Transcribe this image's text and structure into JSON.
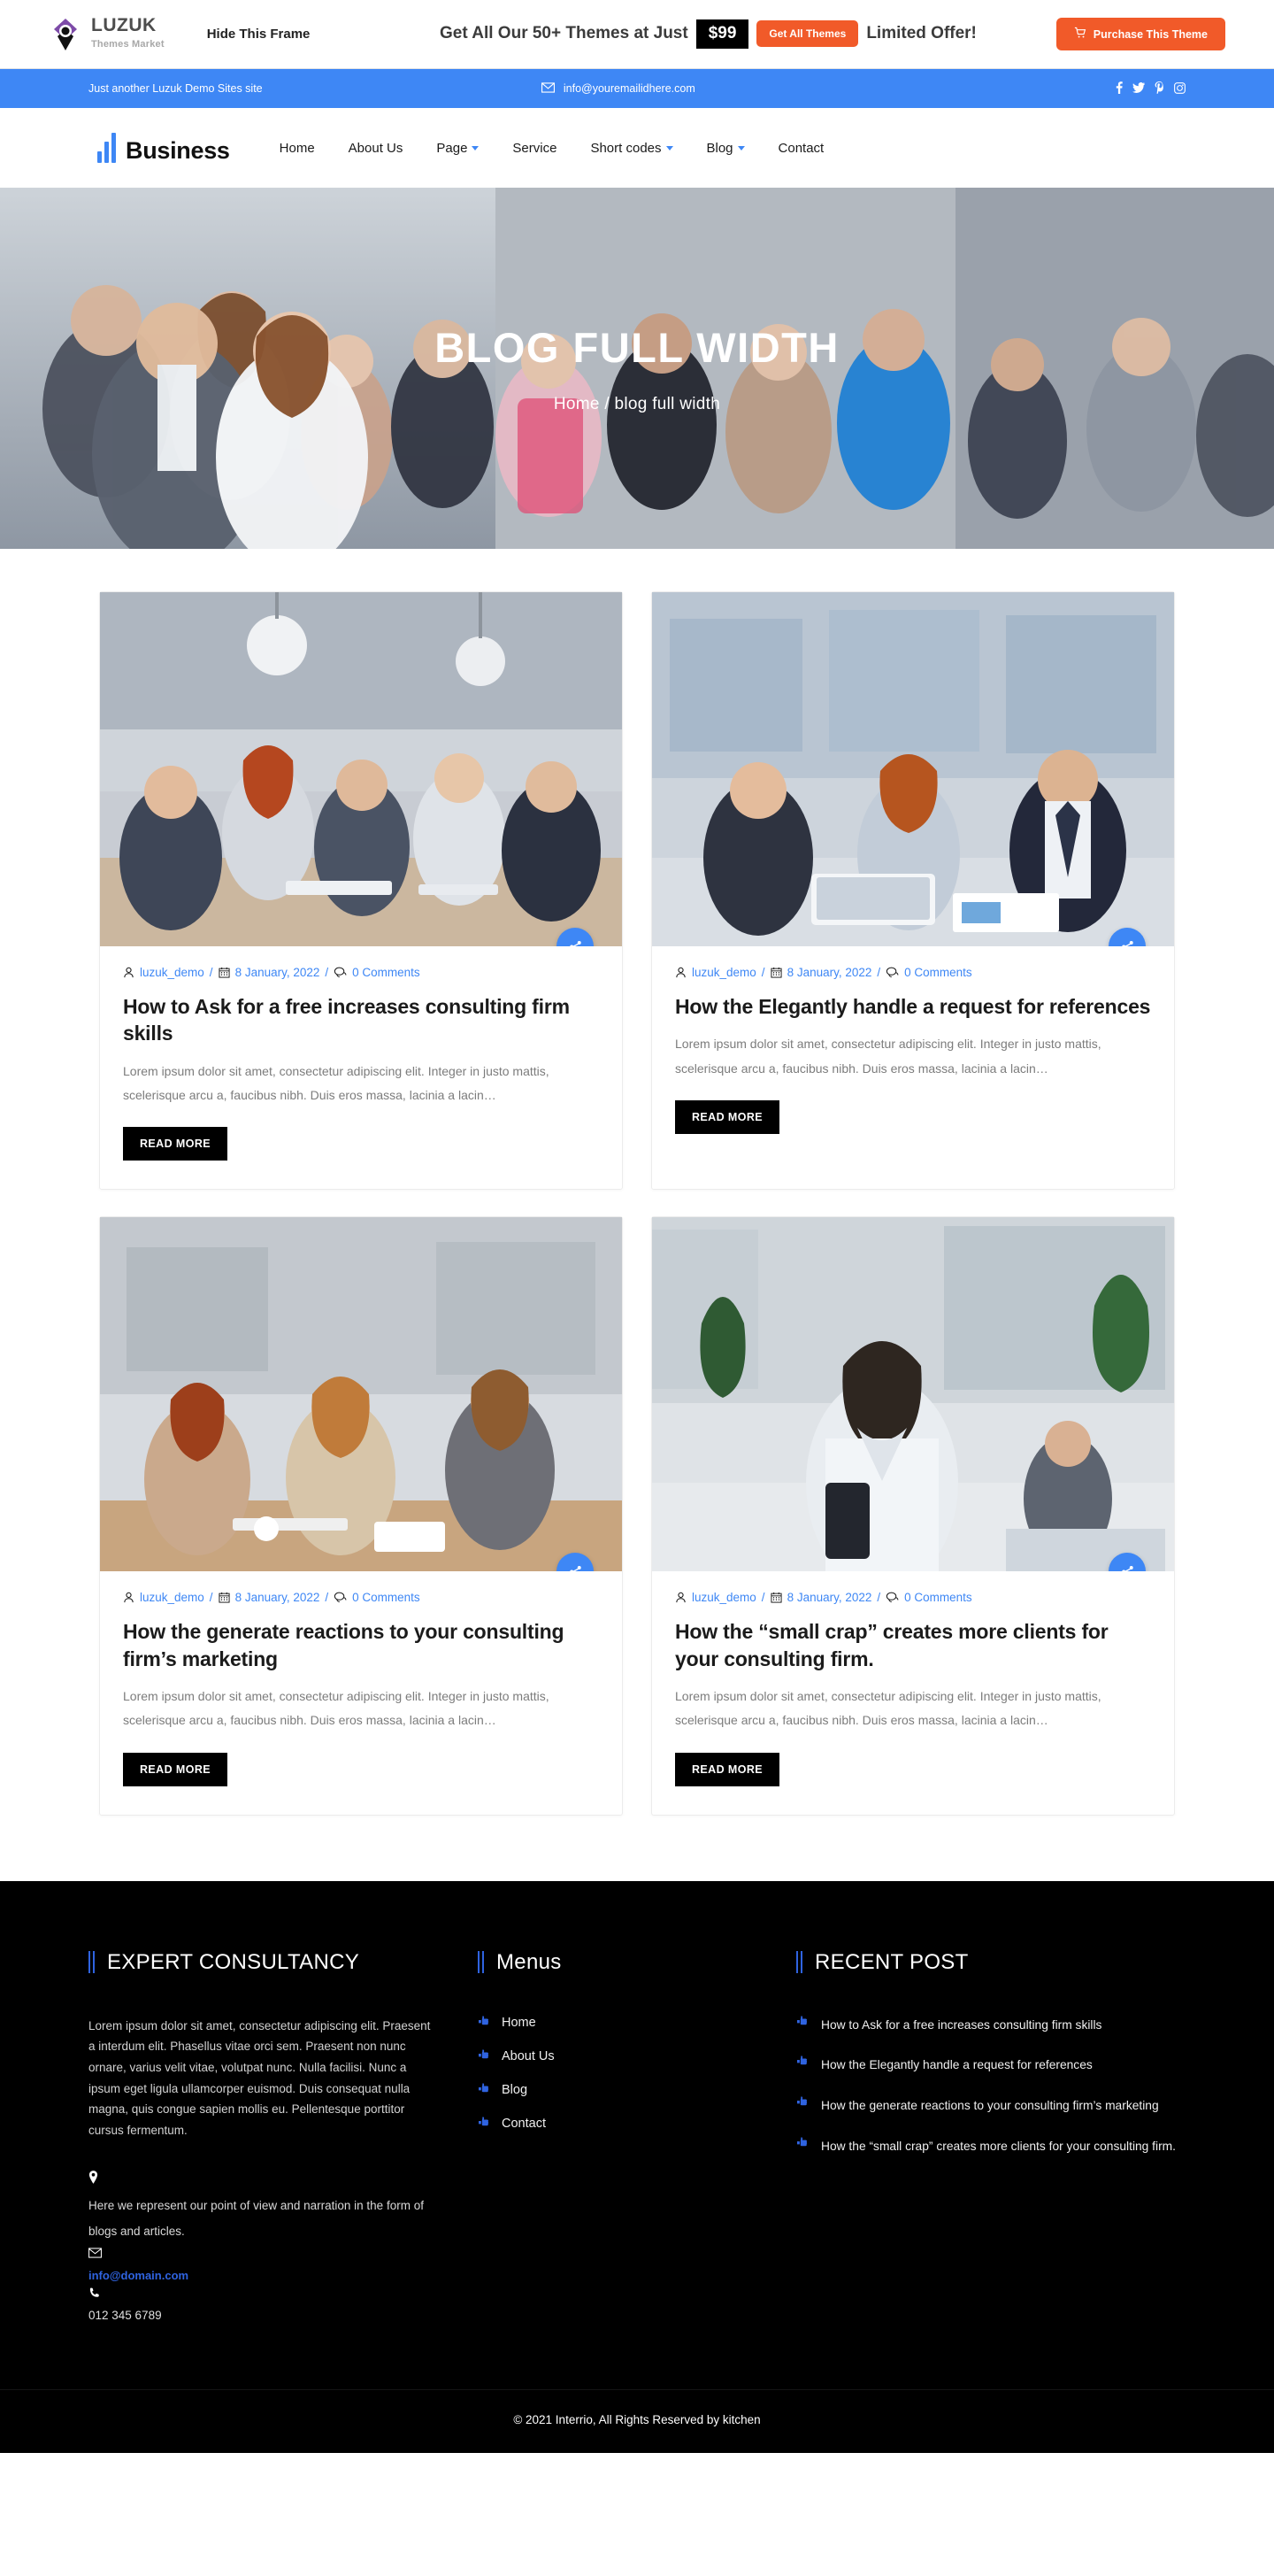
{
  "promo": {
    "logo_name": "LUZUK",
    "logo_sub": "Themes Market",
    "hide_frame_label": "Hide This Frame",
    "offer_text": "Get All Our 50+ Themes at Just",
    "price": "$99",
    "cta_label": "Get All Themes",
    "limited_label": "Limited Offer!",
    "purchase_label": "Purchase This Theme",
    "accent_color": "#f15a29"
  },
  "info_bar": {
    "tagline": "Just another Luzuk Demo Sites site",
    "email": "info@youremailidhere.com",
    "social": [
      "facebook-icon",
      "twitter-icon",
      "pinterest-icon",
      "instagram-icon"
    ],
    "background_color": "#3e87f5"
  },
  "nav": {
    "brand": "Business",
    "items": [
      {
        "label": "Home",
        "has_dropdown": false
      },
      {
        "label": "About Us",
        "has_dropdown": false
      },
      {
        "label": "Page",
        "has_dropdown": true
      },
      {
        "label": "Service",
        "has_dropdown": false
      },
      {
        "label": "Short codes",
        "has_dropdown": true
      },
      {
        "label": "Blog",
        "has_dropdown": true
      },
      {
        "label": "Contact",
        "has_dropdown": false
      }
    ]
  },
  "hero": {
    "title": "BLOG FULL WIDTH",
    "breadcrumb": "Home / blog full width"
  },
  "blog": {
    "read_more_label": "READ MORE",
    "share_icon": "share-icon",
    "posts": [
      {
        "author": "luzuk_demo",
        "date": "8 January, 2022",
        "comments": "0 Comments",
        "title": "How to Ask for a free increases consulting firm skills",
        "excerpt": "Lorem ipsum dolor sit amet, consectetur adipiscing elit. Integer in justo mattis, scelerisque arcu a, faucibus nibh. Duis eros massa, lacinia a lacin…"
      },
      {
        "author": "luzuk_demo",
        "date": "8 January, 2022",
        "comments": "0 Comments",
        "title": "How the Elegantly handle a request for references",
        "excerpt": "Lorem ipsum dolor sit amet, consectetur adipiscing elit. Integer in justo mattis, scelerisque arcu a, faucibus nibh. Duis eros massa, lacinia a lacin…"
      },
      {
        "author": "luzuk_demo",
        "date": "8 January, 2022",
        "comments": "0 Comments",
        "title": "How the generate reactions to your consulting firm’s marketing",
        "excerpt": "Lorem ipsum dolor sit amet, consectetur adipiscing elit. Integer in justo mattis, scelerisque arcu a, faucibus nibh. Duis eros massa, lacinia a lacin…"
      },
      {
        "author": "luzuk_demo",
        "date": "8 January, 2022",
        "comments": "0 Comments",
        "title": "How the “small crap” creates more clients for your consulting firm.",
        "excerpt": "Lorem ipsum dolor sit amet, consectetur adipiscing elit. Integer in justo mattis, scelerisque arcu a, faucibus nibh. Duis eros massa, lacinia a lacin…"
      }
    ]
  },
  "footer": {
    "about": {
      "heading": "EXPERT CONSULTANCY",
      "text": "Lorem ipsum dolor sit amet, consectetur adipiscing elit. Praesent a interdum elit. Phasellus vitae orci sem. Praesent non nunc ornare, varius velit vitae, volutpat nunc. Nulla facilisi. Nunc a ipsum eget ligula ullamcorper euismod. Duis consequat nulla magna, quis congue sapien mollis eu. Pellentesque porttitor cursus fermentum.",
      "address": "Here we represent our point of view and narration in the form of blogs and articles.",
      "email": "info@domain.com",
      "phone": "012 345 6789"
    },
    "menus": {
      "heading": "Menus",
      "items": [
        "Home",
        "About Us",
        "Blog",
        "Contact"
      ]
    },
    "recent": {
      "heading": "RECENT POST",
      "items": [
        "How to Ask for a free increases consulting firm skills",
        "How the Elegantly handle a request for references",
        "How the generate reactions to your consulting firm’s marketing",
        "How the “small crap” creates more clients for your consulting firm."
      ]
    },
    "copyright": "© 2021 Interrio, All Rights Reserved by kitchen",
    "accent_color": "#2f63e0"
  }
}
